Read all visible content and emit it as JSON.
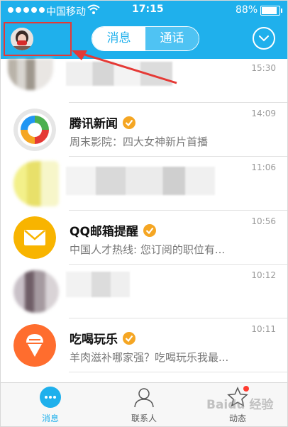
{
  "status_bar": {
    "carrier": "中国移动",
    "time": "17:15",
    "battery": "88%",
    "battery_level": 0.88
  },
  "header": {
    "tabs": [
      {
        "label": "消息",
        "active": true
      },
      {
        "label": "通话",
        "active": false
      }
    ]
  },
  "conversations": [
    {
      "name": "",
      "message": "",
      "time": "15:30",
      "verified": false,
      "icon": "pixelated-avatar"
    },
    {
      "name": "腾讯新闻",
      "message": "周末影院：四大女神新片首播",
      "time": "14:09",
      "verified": true,
      "icon": "tencent-news-icon"
    },
    {
      "name": "",
      "message": "",
      "time": "11:06",
      "verified": false,
      "icon": "pixelated-avatar"
    },
    {
      "name": "QQ邮箱提醒",
      "message": "中国人才热线: 您订阅的职位有...",
      "time": "10:56",
      "verified": true,
      "icon": "mail-icon"
    },
    {
      "name": "",
      "message": "",
      "time": "10:12",
      "verified": false,
      "icon": "pixelated-avatar"
    },
    {
      "name": "吃喝玩乐",
      "message": "羊肉滋补哪家强？吃喝玩乐我最...",
      "time": "10:11",
      "verified": true,
      "icon": "ice-cream-icon"
    }
  ],
  "tabbar": {
    "items": [
      {
        "label": "消息",
        "icon": "chat-icon"
      },
      {
        "label": "联系人",
        "icon": "contacts-icon"
      },
      {
        "label": "动态",
        "icon": "star-icon"
      }
    ]
  },
  "watermark": "Baidu 经验",
  "colors": {
    "accent": "#1fb0ec",
    "annotation": "#e53935",
    "badge": "#ff3b30"
  }
}
